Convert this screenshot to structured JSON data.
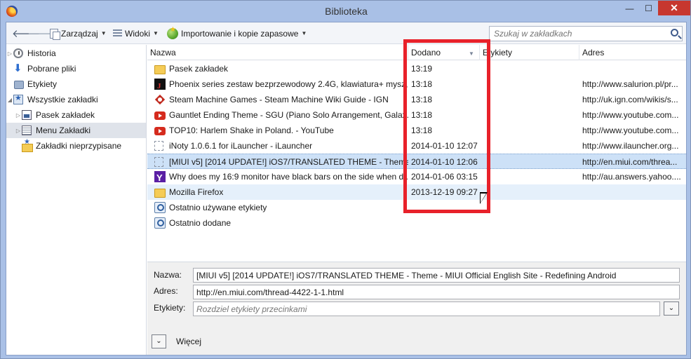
{
  "window": {
    "title": "Biblioteka",
    "min_glyph": "—",
    "max_glyph": "☐",
    "close_glyph": "✕"
  },
  "toolbar": {
    "back_glyph": "🡐",
    "forward_glyph": "🡒",
    "organize_label": "Zarządzaj",
    "views_label": "Widoki",
    "import_label": "Importowanie i kopie zapasowe",
    "search_placeholder": "Szukaj w zakładkach"
  },
  "sidebar": {
    "items": [
      {
        "label": "Historia",
        "icon": "history-icon"
      },
      {
        "label": "Pobrane pliki",
        "icon": "downloads-icon"
      },
      {
        "label": "Etykiety",
        "icon": "tags-icon"
      },
      {
        "label": "Wszystkie zakładki",
        "icon": "all-bookmarks-icon"
      },
      {
        "label": "Pasek zakładek",
        "icon": "bookmarks-toolbar-icon"
      },
      {
        "label": "Menu Zakładki",
        "icon": "bookmarks-menu-icon"
      },
      {
        "label": "Zakładki nieprzypisane",
        "icon": "unsorted-bookmarks-icon"
      }
    ]
  },
  "list": {
    "columns": {
      "name": "Nazwa",
      "added": "Dodano",
      "tags": "Etykiety",
      "url": "Adres"
    },
    "rows": [
      {
        "name": "Pasek zakładek",
        "added": "13:19",
        "tags": "",
        "url": "",
        "icon": "folder-icon"
      },
      {
        "name": "Phoenix series zestaw bezprzewodowy 2.4G, klawiatura+ mysz,...",
        "added": "13:18",
        "tags": "",
        "url": "http://www.salurion.pl/pr...",
        "icon": "site-favicon-icon"
      },
      {
        "name": "Steam Machine Games - Steam Machine Wiki Guide - IGN",
        "added": "13:18",
        "tags": "",
        "url": "http://uk.ign.com/wikis/s...",
        "icon": "ign-favicon-icon"
      },
      {
        "name": "Gauntlet Ending Theme - SGU (Piano Solo Arrangement, Galax...",
        "added": "13:18",
        "tags": "",
        "url": "http://www.youtube.com...",
        "icon": "youtube-icon"
      },
      {
        "name": "TOP10: Harlem Shake in Poland. - YouTube",
        "added": "13:18",
        "tags": "",
        "url": "http://www.youtube.com...",
        "icon": "youtube-icon"
      },
      {
        "name": "iNoty 1.0.6.1 for iLauncher - iLauncher",
        "added": "2014-01-10 12:07",
        "tags": "",
        "url": "http://www.ilauncher.org...",
        "icon": "blank-page-icon"
      },
      {
        "name": "[MIUI v5] [2014 UPDATE!] iOS7/TRANSLATED THEME - Theme...",
        "added": "2014-01-10 12:06",
        "tags": "",
        "url": "http://en.miui.com/threa...",
        "icon": "blank-page-icon"
      },
      {
        "name": "Why does my 16:9 monitor have black bars on the side when d...",
        "added": "2014-01-06 03:15",
        "tags": "",
        "url": "http://au.answers.yahoo....",
        "icon": "yahoo-icon"
      },
      {
        "name": "Mozilla Firefox",
        "added": "2013-12-19 09:27",
        "tags": "",
        "url": "",
        "icon": "folder-icon"
      },
      {
        "name": "Ostatnio używane etykiety",
        "added": "",
        "tags": "",
        "url": "",
        "icon": "smart-query-icon"
      },
      {
        "name": "Ostatnio dodane",
        "added": "",
        "tags": "",
        "url": "",
        "icon": "smart-query-icon"
      }
    ],
    "selected_index": 6,
    "hover_index": 8
  },
  "details": {
    "name_label": "Nazwa:",
    "name_value": "[MIUI v5] [2014 UPDATE!] iOS7/TRANSLATED THEME - Theme - MIUI Official English Site - Redefining Android",
    "url_label": "Adres:",
    "url_value": "http://en.miui.com/thread-4422-1-1.html",
    "tags_label": "Etykiety:",
    "tags_placeholder": "Rozdziel etykiety przecinkami",
    "more_label": "Więcej",
    "dropdown_glyph": "⌄"
  },
  "colors": {
    "highlight": "#e8212a",
    "selection": "#cde1f7",
    "frame": "#a9c0e6",
    "close_button": "#c7372f"
  }
}
